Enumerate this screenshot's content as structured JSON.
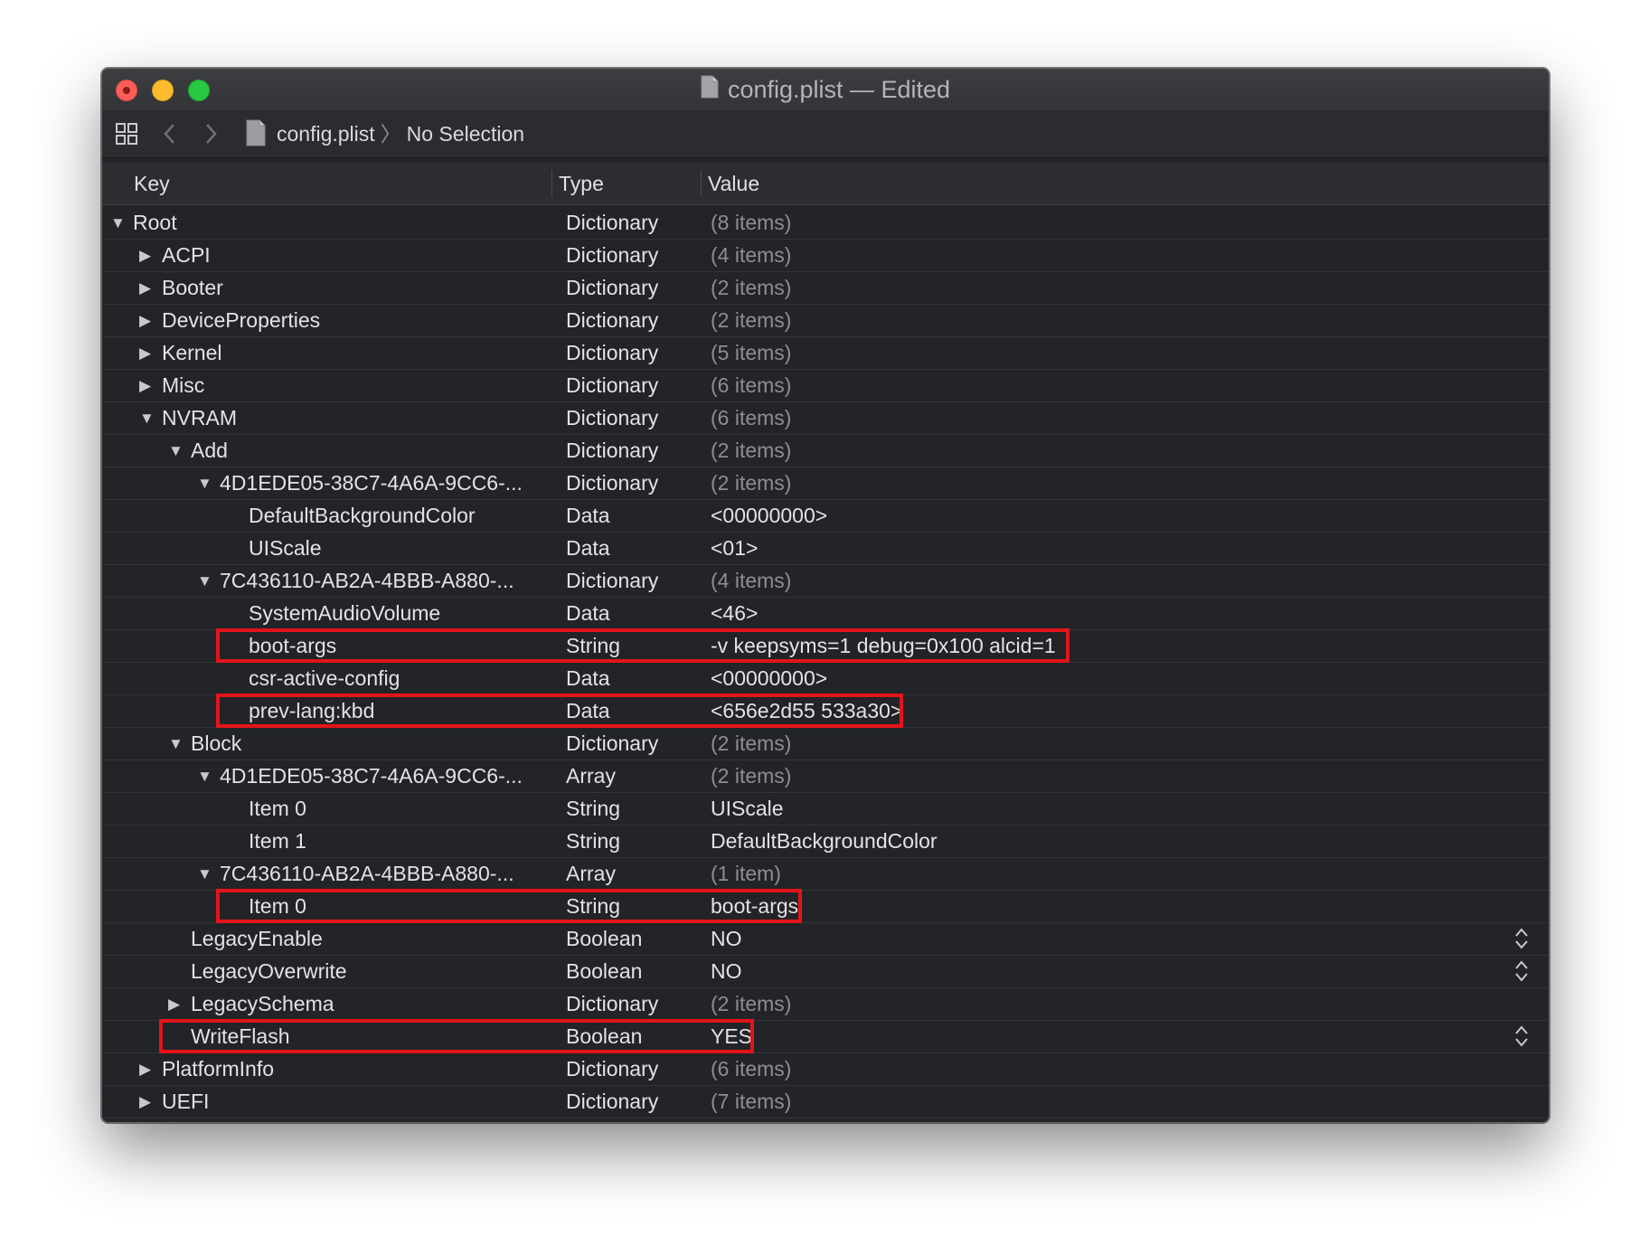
{
  "window": {
    "title": "config.plist — Edited"
  },
  "toolbar": {
    "breadcrumb": {
      "file": "config.plist",
      "separator": "〉",
      "selection": "No Selection"
    }
  },
  "columns": {
    "key": "Key",
    "type": "Type",
    "value": "Value"
  },
  "colors": {
    "highlight": "#e3141b",
    "window_bg": "#232427",
    "close": "#fc5f57",
    "minimize": "#fdbc2e",
    "maximize": "#28c840"
  },
  "rows": [
    {
      "key": "Root",
      "type": "Dictionary",
      "value": "(8 items)",
      "depth": 0,
      "disclosure": "expanded",
      "dim": true
    },
    {
      "key": "ACPI",
      "type": "Dictionary",
      "value": "(4 items)",
      "depth": 1,
      "disclosure": "collapsed",
      "dim": true
    },
    {
      "key": "Booter",
      "type": "Dictionary",
      "value": "(2 items)",
      "depth": 1,
      "disclosure": "collapsed",
      "dim": true
    },
    {
      "key": "DeviceProperties",
      "type": "Dictionary",
      "value": "(2 items)",
      "depth": 1,
      "disclosure": "collapsed",
      "dim": true
    },
    {
      "key": "Kernel",
      "type": "Dictionary",
      "value": "(5 items)",
      "depth": 1,
      "disclosure": "collapsed",
      "dim": true
    },
    {
      "key": "Misc",
      "type": "Dictionary",
      "value": "(6 items)",
      "depth": 1,
      "disclosure": "collapsed",
      "dim": true
    },
    {
      "key": "NVRAM",
      "type": "Dictionary",
      "value": "(6 items)",
      "depth": 1,
      "disclosure": "expanded",
      "dim": true
    },
    {
      "key": "Add",
      "type": "Dictionary",
      "value": "(2 items)",
      "depth": 2,
      "disclosure": "expanded",
      "dim": true
    },
    {
      "key": "4D1EDE05-38C7-4A6A-9CC6-...",
      "type": "Dictionary",
      "value": "(2 items)",
      "depth": 3,
      "disclosure": "expanded",
      "dim": true
    },
    {
      "key": "DefaultBackgroundColor",
      "type": "Data",
      "value": "<00000000>",
      "depth": 4
    },
    {
      "key": "UIScale",
      "type": "Data",
      "value": "<01>",
      "depth": 4
    },
    {
      "key": "7C436110-AB2A-4BBB-A880-...",
      "type": "Dictionary",
      "value": "(4 items)",
      "depth": 3,
      "disclosure": "expanded",
      "dim": true
    },
    {
      "key": "SystemAudioVolume",
      "type": "Data",
      "value": "<46>",
      "depth": 4
    },
    {
      "key": "boot-args",
      "type": "String",
      "value": "-v keepsyms=1 debug=0x100 alcid=1",
      "depth": 4,
      "highlighted": true
    },
    {
      "key": "csr-active-config",
      "type": "Data",
      "value": "<00000000>",
      "depth": 4
    },
    {
      "key": "prev-lang:kbd",
      "type": "Data",
      "value": "<656e2d55 533a30>",
      "depth": 4,
      "highlighted": true
    },
    {
      "key": "Block",
      "type": "Dictionary",
      "value": "(2 items)",
      "depth": 2,
      "disclosure": "expanded",
      "dim": true
    },
    {
      "key": "4D1EDE05-38C7-4A6A-9CC6-...",
      "type": "Array",
      "value": "(2 items)",
      "depth": 3,
      "disclosure": "expanded",
      "dim": true
    },
    {
      "key": "Item 0",
      "type": "String",
      "value": "UIScale",
      "depth": 4
    },
    {
      "key": "Item 1",
      "type": "String",
      "value": "DefaultBackgroundColor",
      "depth": 4
    },
    {
      "key": "7C436110-AB2A-4BBB-A880-...",
      "type": "Array",
      "value": "(1 item)",
      "depth": 3,
      "disclosure": "expanded",
      "dim": true
    },
    {
      "key": "Item 0",
      "type": "String",
      "value": "boot-args",
      "depth": 4,
      "highlighted": true
    },
    {
      "key": "LegacyEnable",
      "type": "Boolean",
      "value": "NO",
      "depth": 2,
      "stepper": true
    },
    {
      "key": "LegacyOverwrite",
      "type": "Boolean",
      "value": "NO",
      "depth": 2,
      "stepper": true
    },
    {
      "key": "LegacySchema",
      "type": "Dictionary",
      "value": "(2 items)",
      "depth": 2,
      "disclosure": "collapsed",
      "dim": true
    },
    {
      "key": "WriteFlash",
      "type": "Boolean",
      "value": "YES",
      "depth": 2,
      "stepper": true,
      "highlighted": true
    },
    {
      "key": "PlatformInfo",
      "type": "Dictionary",
      "value": "(6 items)",
      "depth": 1,
      "disclosure": "collapsed",
      "dim": true
    },
    {
      "key": "UEFI",
      "type": "Dictionary",
      "value": "(7 items)",
      "depth": 1,
      "disclosure": "collapsed",
      "dim": true
    }
  ]
}
